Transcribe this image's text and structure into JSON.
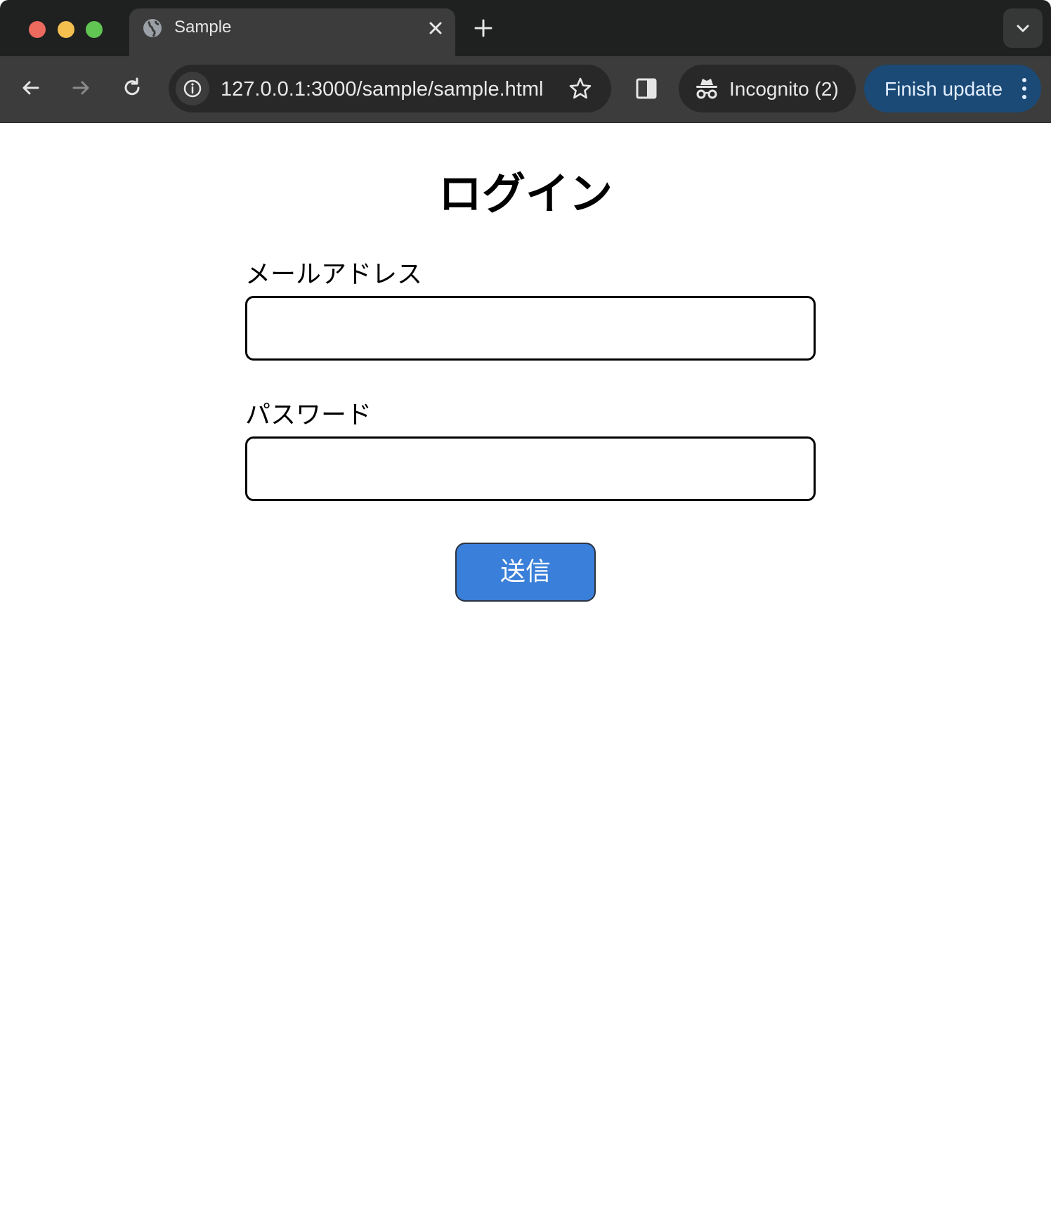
{
  "browser": {
    "tab": {
      "title": "Sample",
      "favicon": "globe-icon"
    },
    "toolbar": {
      "url": "127.0.0.1:3000/sample/sample.html",
      "incognito_label": "Incognito (2)",
      "update_label": "Finish update"
    },
    "icons": {
      "back": "arrow-left-icon",
      "forward": "arrow-right-icon",
      "reload": "reload-icon",
      "site_info": "info-icon",
      "bookmark": "star-icon",
      "side_panel": "side-panel-icon",
      "incognito": "incognito-icon",
      "menu": "more-vertical-icon",
      "new_tab": "plus-icon",
      "close_tab": "close-icon",
      "tab_search": "chevron-down-icon"
    },
    "colors": {
      "tabstrip": "#1f2020",
      "toolbar": "#3c3c3c",
      "update_button": "#1c4a76"
    }
  },
  "page": {
    "title": "ログイン",
    "email_label": "メールアドレス",
    "email_value": "",
    "password_label": "パスワード",
    "password_value": "",
    "submit_label": "送信",
    "colors": {
      "submit_button": "#3a7fd9"
    }
  }
}
